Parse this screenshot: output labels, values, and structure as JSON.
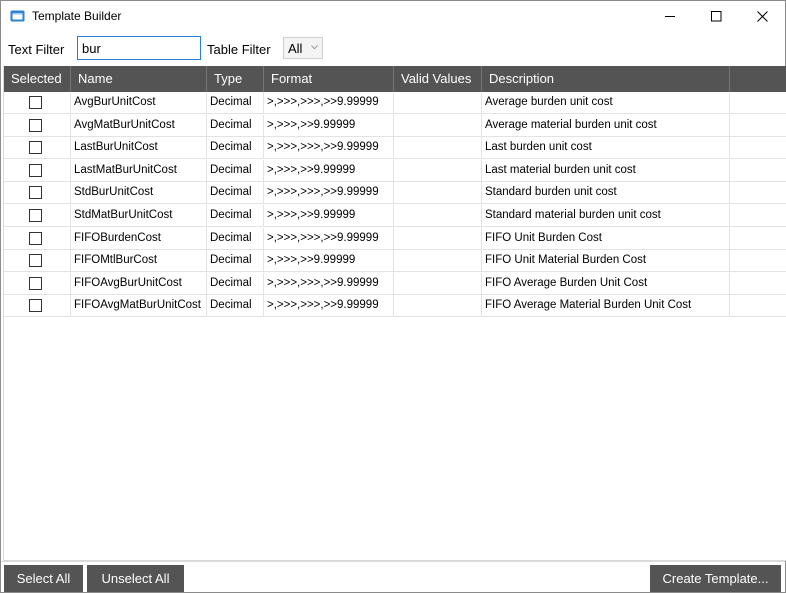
{
  "window": {
    "title": "Template Builder",
    "icon": "app-window-icon",
    "controls": [
      "minimize-icon",
      "maximize-icon",
      "close-icon"
    ]
  },
  "filters": {
    "text_filter_label": "Text Filter",
    "text_filter_value": "bur",
    "table_filter_label": "Table Filter",
    "table_filter_value": "All"
  },
  "table": {
    "columns": [
      "Selected",
      "Name",
      "Type",
      "Format",
      "Valid Values",
      "Description"
    ],
    "rows": [
      {
        "selected": false,
        "name": "AvgBurUnitCost",
        "type": "Decimal",
        "format": ">,>>>,>>>,>>9.99999",
        "valid_values": "",
        "description": "Average burden unit cost"
      },
      {
        "selected": false,
        "name": "AvgMatBurUnitCost",
        "type": "Decimal",
        "format": ">,>>>,>>9.99999",
        "valid_values": "",
        "description": "Average material burden unit cost"
      },
      {
        "selected": false,
        "name": "LastBurUnitCost",
        "type": "Decimal",
        "format": ">,>>>,>>>,>>9.99999",
        "valid_values": "",
        "description": "Last burden unit cost"
      },
      {
        "selected": false,
        "name": "LastMatBurUnitCost",
        "type": "Decimal",
        "format": ">,>>>,>>9.99999",
        "valid_values": "",
        "description": "Last material burden unit cost"
      },
      {
        "selected": false,
        "name": "StdBurUnitCost",
        "type": "Decimal",
        "format": ">,>>>,>>>,>>9.99999",
        "valid_values": "",
        "description": "Standard burden unit cost"
      },
      {
        "selected": false,
        "name": "StdMatBurUnitCost",
        "type": "Decimal",
        "format": ">,>>>,>>9.99999",
        "valid_values": "",
        "description": "Standard material burden unit cost"
      },
      {
        "selected": false,
        "name": "FIFOBurdenCost",
        "type": "Decimal",
        "format": ">,>>>,>>>,>>9.99999",
        "valid_values": "",
        "description": "FIFO Unit Burden Cost"
      },
      {
        "selected": false,
        "name": "FIFOMtlBurCost",
        "type": "Decimal",
        "format": ">,>>>,>>9.99999",
        "valid_values": "",
        "description": "FIFO Unit Material Burden Cost"
      },
      {
        "selected": false,
        "name": "FIFOAvgBurUnitCost",
        "type": "Decimal",
        "format": ">,>>>,>>>,>>9.99999",
        "valid_values": "",
        "description": "FIFO Average Burden Unit Cost"
      },
      {
        "selected": false,
        "name": "FIFOAvgMatBurUnitCost",
        "type": "Decimal",
        "format": ">,>>>,>>>,>>9.99999",
        "valid_values": "",
        "description": "FIFO Average Material Burden Unit Cost"
      }
    ]
  },
  "buttons": {
    "select_all": "Select All",
    "unselect_all": "Unselect All",
    "create_template": "Create Template..."
  },
  "colors": {
    "header_bg": "#545454",
    "button_bg": "#545454",
    "input_focus_border": "#2a7fd8",
    "app_icon": "#2b83d3"
  }
}
